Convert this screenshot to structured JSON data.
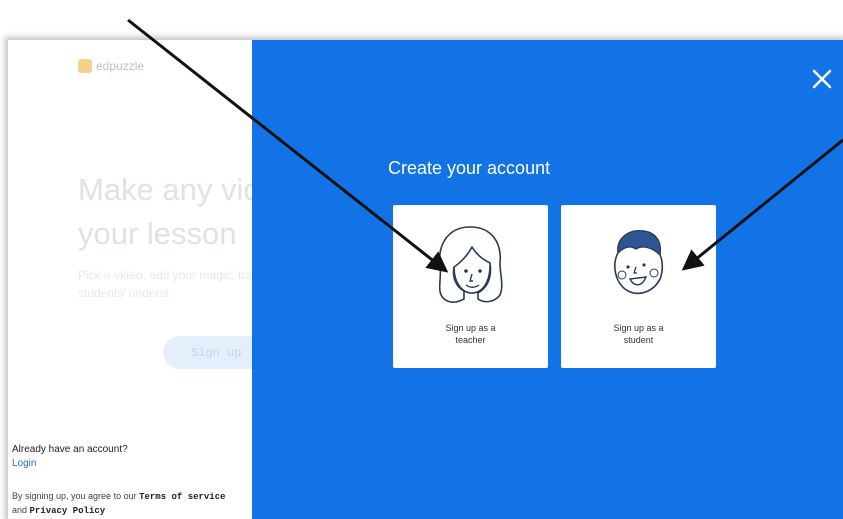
{
  "left": {
    "logo_text": "edpuzzle",
    "hero_title": "Make any vid your lesson",
    "hero_subtitle": "Pick a video, add your magic, track your students' underst",
    "signup_button": "Sign up",
    "have_account": "Already have an account?",
    "login_link": "Login",
    "terms_prefix": "By signing up, you agree to our ",
    "terms_link": "Terms of service",
    "terms_and": " and ",
    "privacy_link": "Privacy Policy"
  },
  "modal": {
    "title": "Create your account",
    "close_icon": "close-icon",
    "cards": [
      {
        "line1": "Sign up as a",
        "line2": "teacher",
        "icon": "teacher-face-icon"
      },
      {
        "line1": "Sign up as a",
        "line2": "student",
        "icon": "student-face-icon"
      }
    ]
  },
  "colors": {
    "modal_blue": "#1273e6",
    "card_bg": "#ffffff",
    "arrow": "#111111"
  }
}
